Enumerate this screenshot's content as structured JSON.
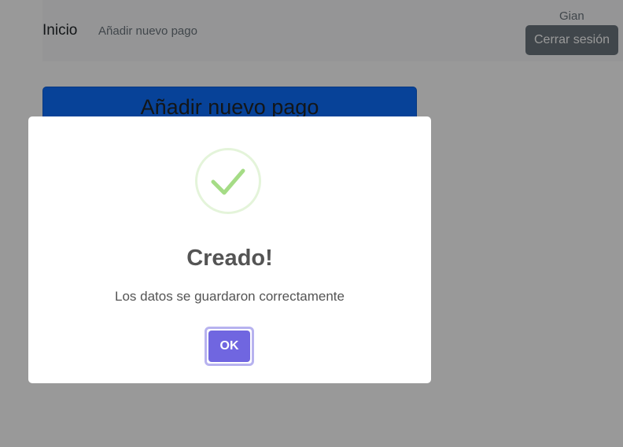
{
  "navbar": {
    "brand": "Inicio",
    "link": "Añadir nuevo pago",
    "username": "Gian",
    "logout_label": "Cerrar sesión"
  },
  "card": {
    "title": "Añadir nuevo pago"
  },
  "modal": {
    "icon": "success-check-icon",
    "title": "Creado!",
    "text": "Los datos se guardaron correctamente",
    "confirm_label": "OK"
  },
  "colors": {
    "primary": "#0d6efd",
    "secondary": "#6c757d",
    "success": "#a5dc86",
    "confirm": "#7066e0"
  }
}
